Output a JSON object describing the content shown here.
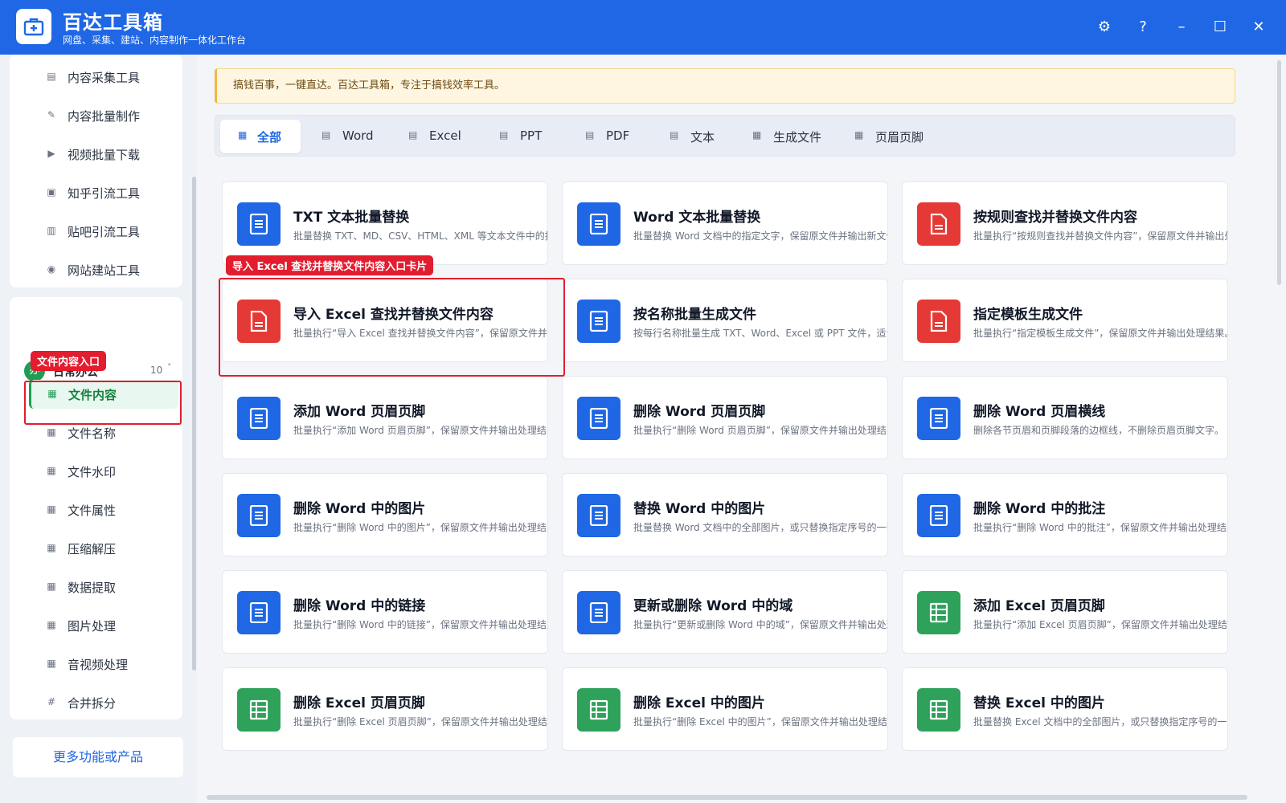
{
  "app": {
    "title": "百达工具箱",
    "subtitle": "网盘、采集、建站、内容制作一体化工作台"
  },
  "window_controls": [
    {
      "name": "settings-button",
      "glyph": "⚙"
    },
    {
      "name": "help-button",
      "glyph": "?"
    },
    {
      "name": "minimize-button",
      "glyph": "–"
    },
    {
      "name": "maximize-button",
      "glyph": "☐"
    },
    {
      "name": "close-button",
      "glyph": "✕"
    }
  ],
  "sidebar": {
    "top_items": [
      {
        "label": "内容采集工具",
        "icon": "doc-icon"
      },
      {
        "label": "内容批量制作",
        "icon": "pen-icon"
      },
      {
        "label": "视频批量下载",
        "icon": "video-icon"
      },
      {
        "label": "知乎引流工具",
        "icon": "zhihu-icon"
      },
      {
        "label": "贴吧引流工具",
        "icon": "tieba-icon"
      },
      {
        "label": "网站建站工具",
        "icon": "globe-icon"
      }
    ],
    "group": {
      "icon_text": "办",
      "name": "日常办公",
      "count": "10"
    },
    "group_items": [
      {
        "label": "文件内容",
        "active": true
      },
      {
        "label": "文件名称"
      },
      {
        "label": "文件水印"
      },
      {
        "label": "文件属性"
      },
      {
        "label": "压缩解压"
      },
      {
        "label": "数据提取"
      },
      {
        "label": "图片处理"
      },
      {
        "label": "音视频处理"
      },
      {
        "label": "合并拆分",
        "icon": "hash-icon"
      }
    ],
    "more_button": "更多功能或产品"
  },
  "annotations": {
    "sidebar_tag": "文件内容入口",
    "card_tag": "导入 Excel 查找并替换文件内容入口卡片"
  },
  "notice": "搞钱百事，一键直达。百达工具箱，专注于搞钱效率工具。",
  "tabs": [
    {
      "label": "全部",
      "active": true
    },
    {
      "label": "Word"
    },
    {
      "label": "Excel"
    },
    {
      "label": "PPT"
    },
    {
      "label": "PDF"
    },
    {
      "label": "文本"
    },
    {
      "label": "生成文件"
    },
    {
      "label": "页眉页脚"
    }
  ],
  "colors": {
    "blue": "#1f67e5",
    "red": "#e53935",
    "green": "#2ea15a",
    "accent_green": "#1f9d55"
  },
  "cards": [
    {
      "title": "TXT 文本批量替换",
      "desc": "批量替换 TXT、MD、CSV、HTML、XML 等文本文件中的指定内容",
      "color": "blue"
    },
    {
      "title": "Word 文本批量替换",
      "desc": "批量替换 Word 文档中的指定文字，保留原文件并输出新文件。",
      "color": "blue"
    },
    {
      "title": "按规则查找并替换文件内容",
      "desc": "批量执行“按规则查找并替换文件内容”，保留原文件并输出处理结果",
      "color": "red"
    },
    {
      "title": "导入 Excel 查找并替换文件内容",
      "desc": "批量执行“导入 Excel 查找并替换文件内容”，保留原文件并输出处理结果",
      "color": "red"
    },
    {
      "title": "按名称批量生成文件",
      "desc": "按每行名称批量生成 TXT、Word、Excel 或 PPT 文件，适合批量",
      "color": "blue"
    },
    {
      "title": "指定模板生成文件",
      "desc": "批量执行“指定模板生成文件”，保留原文件并输出处理结果。",
      "color": "red"
    },
    {
      "title": "添加 Word 页眉页脚",
      "desc": "批量执行“添加 Word 页眉页脚”，保留原文件并输出处理结果。",
      "color": "blue"
    },
    {
      "title": "删除 Word 页眉页脚",
      "desc": "批量执行“删除 Word 页眉页脚”，保留原文件并输出处理结果。",
      "color": "blue"
    },
    {
      "title": "删除 Word 页眉横线",
      "desc": "删除各节页眉和页脚段落的边框线，不删除页眉页脚文字。",
      "color": "blue"
    },
    {
      "title": "删除 Word 中的图片",
      "desc": "批量执行“删除 Word 中的图片”，保留原文件并输出处理结果。",
      "color": "blue"
    },
    {
      "title": "替换 Word 中的图片",
      "desc": "批量替换 Word 文档中的全部图片，或只替换指定序号的一张图片",
      "color": "blue"
    },
    {
      "title": "删除 Word 中的批注",
      "desc": "批量执行“删除 Word 中的批注”，保留原文件并输出处理结果。",
      "color": "blue"
    },
    {
      "title": "删除 Word 中的链接",
      "desc": "批量执行“删除 Word 中的链接”，保留原文件并输出处理结果。",
      "color": "blue"
    },
    {
      "title": "更新或删除 Word 中的域",
      "desc": "批量执行“更新或删除 Word 中的域”，保留原文件并输出处理结果",
      "color": "blue"
    },
    {
      "title": "添加 Excel 页眉页脚",
      "desc": "批量执行“添加 Excel 页眉页脚”，保留原文件并输出处理结果。",
      "color": "green"
    },
    {
      "title": "删除 Excel 页眉页脚",
      "desc": "批量执行“删除 Excel 页眉页脚”，保留原文件并输出处理结果。",
      "color": "green"
    },
    {
      "title": "删除 Excel 中的图片",
      "desc": "批量执行“删除 Excel 中的图片”，保留原文件并输出处理结果。",
      "color": "green"
    },
    {
      "title": "替换 Excel 中的图片",
      "desc": "批量替换 Excel 文档中的全部图片，或只替换指定序号的一张图片",
      "color": "green"
    }
  ]
}
